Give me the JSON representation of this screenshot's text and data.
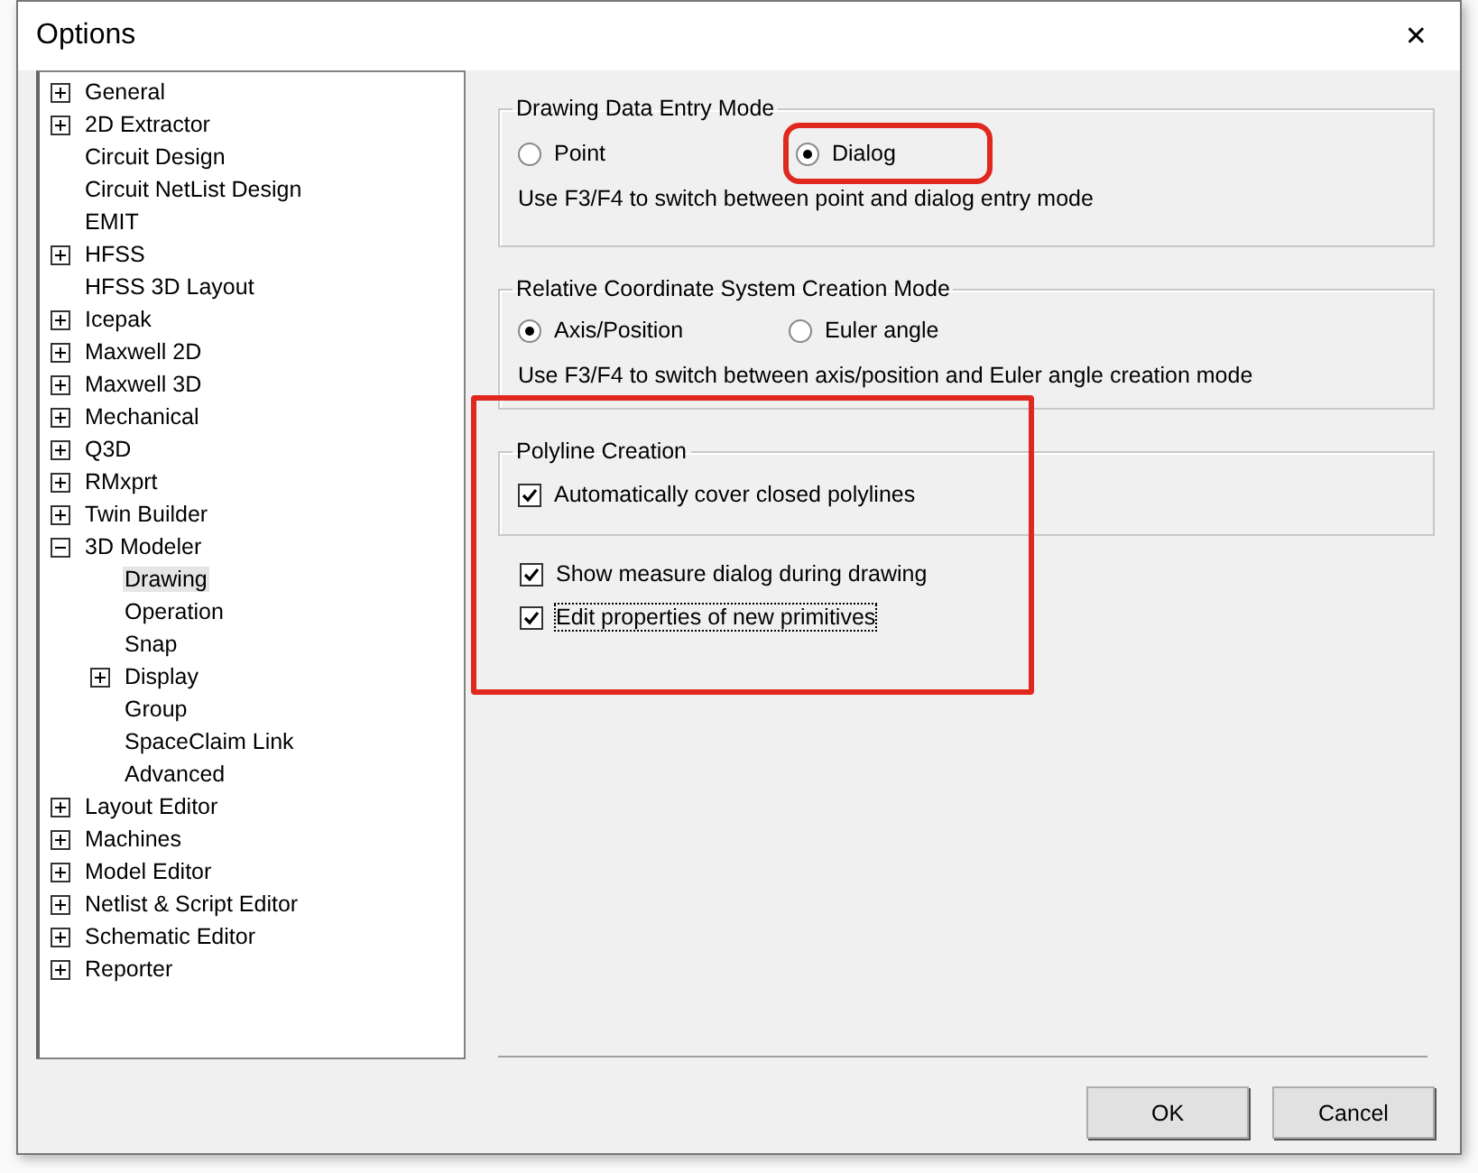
{
  "window": {
    "title": "Options",
    "close": "✕"
  },
  "tree": [
    {
      "label": "General",
      "kind": "branch",
      "expanded": false,
      "selected": false
    },
    {
      "label": "2D Extractor",
      "kind": "branch",
      "expanded": false,
      "selected": false
    },
    {
      "label": "Circuit Design",
      "kind": "leaf",
      "selected": false
    },
    {
      "label": "Circuit NetList Design",
      "kind": "leaf",
      "selected": false
    },
    {
      "label": "EMIT",
      "kind": "leaf",
      "selected": false
    },
    {
      "label": "HFSS",
      "kind": "branch",
      "expanded": false,
      "selected": false
    },
    {
      "label": "HFSS 3D Layout",
      "kind": "leaf",
      "selected": false
    },
    {
      "label": "Icepak",
      "kind": "branch",
      "expanded": false,
      "selected": false
    },
    {
      "label": "Maxwell 2D",
      "kind": "branch",
      "expanded": false,
      "selected": false
    },
    {
      "label": "Maxwell 3D",
      "kind": "branch",
      "expanded": false,
      "selected": false
    },
    {
      "label": "Mechanical",
      "kind": "branch",
      "expanded": false,
      "selected": false
    },
    {
      "label": "Q3D",
      "kind": "branch",
      "expanded": false,
      "selected": false
    },
    {
      "label": "RMxprt",
      "kind": "branch",
      "expanded": false,
      "selected": false
    },
    {
      "label": "Twin Builder",
      "kind": "branch",
      "expanded": false,
      "selected": false
    },
    {
      "label": "3D Modeler",
      "kind": "branch",
      "expanded": true,
      "selected": false,
      "children": [
        {
          "label": "Drawing",
          "kind": "leaf",
          "selected": true
        },
        {
          "label": "Operation",
          "kind": "leaf",
          "selected": false
        },
        {
          "label": "Snap",
          "kind": "leaf",
          "selected": false
        },
        {
          "label": "Display",
          "kind": "branch",
          "expanded": false,
          "selected": false
        },
        {
          "label": "Group",
          "kind": "leaf",
          "selected": false
        },
        {
          "label": "SpaceClaim Link",
          "kind": "leaf",
          "selected": false
        },
        {
          "label": "Advanced",
          "kind": "leaf",
          "selected": false
        }
      ]
    },
    {
      "label": "Layout Editor",
      "kind": "branch",
      "expanded": false,
      "selected": false
    },
    {
      "label": "Machines",
      "kind": "branch",
      "expanded": false,
      "selected": false
    },
    {
      "label": "Model Editor",
      "kind": "branch",
      "expanded": false,
      "selected": false
    },
    {
      "label": "Netlist & Script Editor",
      "kind": "branch",
      "expanded": false,
      "selected": false
    },
    {
      "label": "Schematic Editor",
      "kind": "branch",
      "expanded": false,
      "selected": false
    },
    {
      "label": "Reporter",
      "kind": "branch",
      "expanded": false,
      "selected": false
    }
  ],
  "entry_mode": {
    "title": "Drawing Data Entry Mode",
    "options": [
      {
        "label": "Point",
        "selected": false,
        "highlighted": false
      },
      {
        "label": "Dialog",
        "selected": true,
        "highlighted": true
      }
    ],
    "hint": "Use F3/F4 to switch between point and dialog entry mode"
  },
  "coordinate_mode": {
    "title": "Relative Coordinate System Creation Mode",
    "options": [
      {
        "label": "Axis/Position",
        "selected": true
      },
      {
        "label": "Euler angle",
        "selected": false
      }
    ],
    "hint": "Use F3/F4 to switch between axis/position and Euler angle creation mode"
  },
  "polyline": {
    "title": "Polyline Creation",
    "highlighted": true,
    "checkbox": {
      "label": "Automatically cover closed polylines",
      "checked": true
    }
  },
  "checkboxes": [
    {
      "label": "Show measure dialog during drawing",
      "checked": true,
      "focused": false
    },
    {
      "label": "Edit properties of new primitives",
      "checked": true,
      "focused": true
    }
  ],
  "buttons": [
    "OK",
    "Cancel"
  ]
}
